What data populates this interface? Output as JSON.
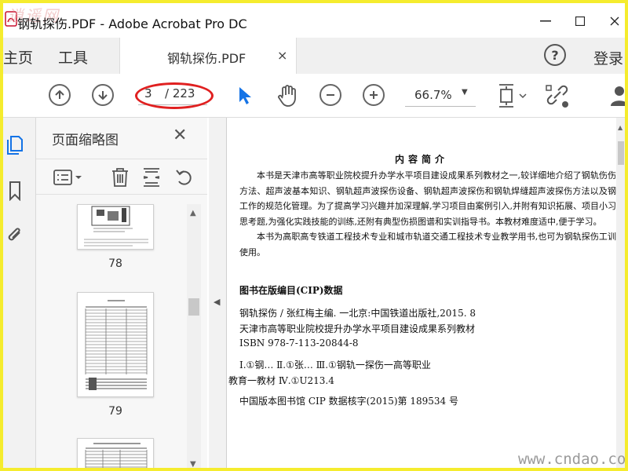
{
  "window": {
    "title": "钢轨探伤.PDF - Adobe Acrobat Pro DC",
    "watermark_top": "逍遥网",
    "minimize": "—",
    "maximize": "☐"
  },
  "tabs": {
    "home": "主页",
    "tools": "工具",
    "document": "钢轨探伤.PDF",
    "document_close": "×",
    "help": "?",
    "login": "登录"
  },
  "toolbar": {
    "current_page": "3",
    "total_pages": "/ 223",
    "zoom": "66.7%",
    "zoom_caret": "▼"
  },
  "thumbnails": {
    "title": "页面缩略图",
    "close": "✕",
    "pages": [
      {
        "label": "78"
      },
      {
        "label": "79"
      }
    ]
  },
  "document": {
    "heading": "内容简介",
    "paragraph1": "本书是天津市高等职业院校提升办学水平项目建设成果系列教材之一,较详细地介绍了钢轨伤伤方法、超声波基本知识、钢轨超声波探伤设备、钢轨超声波探伤和钢轨焊缝超声波探伤方法以及钢工作的规范化管理。为了提高学习兴趣并加深理解,学习项目由案例引入,并附有知识拓展、项目小习思考题,为强化实践技能的训练,还附有典型伤损图谱和实训指导书。本教材难度适中,便于学习。",
    "paragraph2": "本书为高职高专铁道工程技术专业和城市轨道交通工程技术专业教学用书,也可为钢轨探伤工训使用。",
    "cip_heading": "图书在版编目(CIP)数据",
    "cip_lines": [
      "钢轨探伤 / 张红梅主编. 一北京:中国铁道出版社,2015. 8",
      "天津市高等职业院校提升办学水平项目建设成果系列教材",
      "ISBN 978-7-113-20844-8",
      "Ⅰ.①钢…   Ⅱ.①张…   Ⅲ.①钢轨一探伤一高等职业",
      "教育一教材   Ⅳ.①U213.4",
      "中国版本图书馆 CIP 数据核字(2015)第 189534 号"
    ]
  },
  "watermark_bottom": "www.cndao.com",
  "colors": {
    "frame": "#f5ec2e",
    "highlight": "#e02020",
    "cursor": "#1473e6"
  }
}
